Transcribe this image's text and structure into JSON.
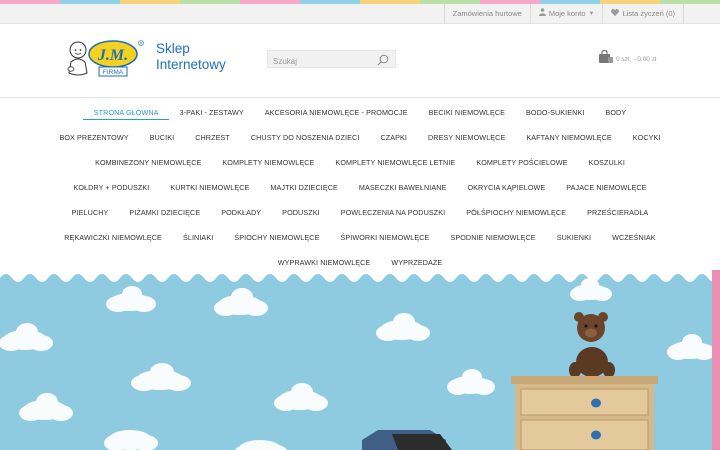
{
  "topbar": {
    "wholesale": "Zamówienia hurtowe",
    "account": "Moje konto",
    "wishlist": "Lista życzeń (0)"
  },
  "brand": {
    "logo_text": "J.M.",
    "logo_sub": "FIRMA",
    "line1": "Sklep",
    "line2": "Internetowy"
  },
  "search": {
    "placeholder": "Szukaj"
  },
  "cart": {
    "summary": "0 szt. - 0,00 zł"
  },
  "nav": {
    "rows": [
      [
        "STRONA GŁÓWNA",
        "3-PAKI - ZESTAWY",
        "AKCESORIA NIEMOWLĘCE - PROMOCJE",
        "BECIKI NIEMOWLĘCE",
        "BODO-SUKIENKI",
        "BODY"
      ],
      [
        "BOX PREZENTOWY",
        "BUCIKI",
        "CHRZEST",
        "CHUSTY DO NOSZENIA DZIECI",
        "CZAPKI",
        "DRESY NIEMOWLĘCE",
        "KAFTANY NIEMOWLĘCE",
        "KOCYKI"
      ],
      [
        "KOMBINEZONY NIEMOWLĘCE",
        "KOMPLETY NIEMOWLĘCE",
        "KOMPLETY NIEMOWLĘCE LETNIE",
        "KOMPLETY POŚCIELOWE",
        "KOSZULKI"
      ],
      [
        "KOŁDRY + PODUSZKI",
        "KURTKI NIEMOWLĘCE",
        "MAJTKI DZIECIĘCE",
        "MASECZKI BAWEŁNIANE",
        "OKRYCIA KĄPIELOWE",
        "PAJACE NIEMOWLĘCE"
      ],
      [
        "PIELUCHY",
        "PIŻAMKI DZIECIĘCE",
        "PODKŁADY",
        "PODUSZKI",
        "POWLECZENIA NA PODUSZKI",
        "PÓŁŚPIOCHY NIEMOWLĘCE",
        "PRZEŚCIERADŁA"
      ],
      [
        "RĘKAWICZKI NIEMOWLĘCE",
        "ŚLINIAKI",
        "ŚPIOCHY NIEMOWLĘCE",
        "ŚPIWORKI NIEMOWLĘCE",
        "SPODNIE NIEMOWLĘCE",
        "SUKIENKI",
        "WCZEŚNIAK"
      ],
      [
        "WYPRAWKI NIEMOWLĘCE",
        "WYPRZEDAŻE"
      ]
    ],
    "active": "STRONA GŁÓWNA"
  },
  "colors": {
    "accent": "#2a9ad6",
    "brand_blue": "#1e6fb8",
    "logo_yellow": "#f4d21f",
    "sky": "#8fcbe0",
    "edge_pink": "#e98fb2"
  },
  "icons": [
    "user-icon",
    "heart-icon",
    "search-icon",
    "cart-icon",
    "caret-down-icon"
  ]
}
